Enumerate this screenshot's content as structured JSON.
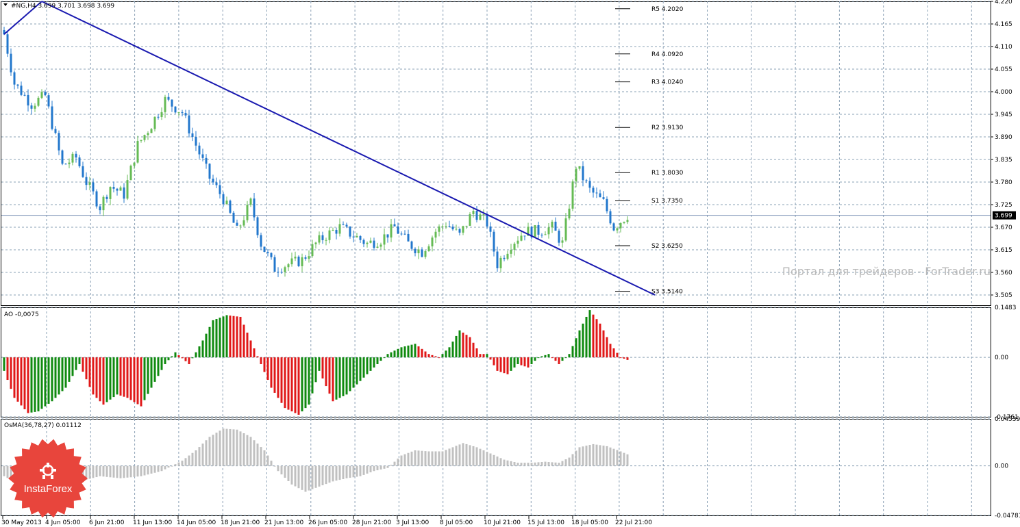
{
  "chart_data": [
    {
      "type": "candlestick",
      "title": "#NG,H4  3.699 3.701 3.698 3.699",
      "symbol": "#NG,H4",
      "ohlc_header": "3.699 3.701 3.698 3.699",
      "ylim": [
        3.48,
        4.22
      ],
      "y_ticks": [
        "4.220",
        "4.165",
        "4.110",
        "4.055",
        "4.000",
        "3.945",
        "3.890",
        "3.835",
        "3.780",
        "3.725",
        "3.670",
        "3.615",
        "3.560",
        "3.505"
      ],
      "current_price_label": "3.699",
      "current_price": 3.699,
      "colors": {
        "bull": "#66bb55",
        "bear": "#2277cc",
        "trendline": "#1a1ab0",
        "grid": "#8aa0b5"
      },
      "close_path": [
        [
          0,
          4.14
        ],
        [
          3,
          4.02
        ],
        [
          8,
          3.97
        ],
        [
          12,
          3.99
        ],
        [
          17,
          3.82
        ],
        [
          21,
          3.84
        ],
        [
          24,
          3.78
        ],
        [
          28,
          3.72
        ],
        [
          31,
          3.77
        ],
        [
          35,
          3.75
        ],
        [
          39,
          3.87
        ],
        [
          43,
          3.92
        ],
        [
          47,
          3.98
        ],
        [
          52,
          3.95
        ],
        [
          56,
          3.87
        ],
        [
          60,
          3.79
        ],
        [
          64,
          3.74
        ],
        [
          68,
          3.66
        ],
        [
          72,
          3.73
        ],
        [
          75,
          3.63
        ],
        [
          79,
          3.57
        ],
        [
          83,
          3.58
        ],
        [
          87,
          3.59
        ],
        [
          91,
          3.63
        ],
        [
          94,
          3.65
        ],
        [
          98,
          3.67
        ],
        [
          102,
          3.65
        ],
        [
          106,
          3.63
        ],
        [
          110,
          3.64
        ],
        [
          114,
          3.67
        ],
        [
          118,
          3.63
        ],
        [
          122,
          3.61
        ],
        [
          126,
          3.66
        ],
        [
          129,
          3.68
        ],
        [
          133,
          3.65
        ],
        [
          137,
          3.71
        ],
        [
          141,
          3.68
        ],
        [
          144,
          3.58
        ],
        [
          148,
          3.63
        ],
        [
          152,
          3.66
        ],
        [
          156,
          3.66
        ],
        [
          160,
          3.67
        ],
        [
          163,
          3.63
        ],
        [
          167,
          3.82
        ],
        [
          171,
          3.76
        ],
        [
          175,
          3.73
        ],
        [
          178,
          3.67
        ],
        [
          182,
          3.7
        ]
      ],
      "trendlines": [
        {
          "from": [
            0,
            4.14
          ],
          "to": [
            11,
            4.22
          ]
        },
        {
          "from": [
            11,
            4.22
          ],
          "to": [
            190,
            3.505
          ]
        }
      ],
      "pivot_levels": [
        {
          "label": "R5  4.2020",
          "value": 4.202
        },
        {
          "label": "R4  4.0920",
          "value": 4.092
        },
        {
          "label": "R3  4.0240",
          "value": 4.024
        },
        {
          "label": "R2  3.9130",
          "value": 3.913
        },
        {
          "label": "R1  3.8030",
          "value": 3.803
        },
        {
          "label": "S1  3.7350",
          "value": 3.735
        },
        {
          "label": "S2  3.6250",
          "value": 3.625
        },
        {
          "label": "S3  3.5140",
          "value": 3.514
        }
      ],
      "watermark": "Портал для трейдеров - ForTrader.ru"
    },
    {
      "type": "bar",
      "title": "AO -0,0075",
      "ylim": [
        -0.1761,
        0.1483
      ],
      "y_ticks": [
        "0.1483",
        "0.00",
        "-0.1761"
      ],
      "colors": {
        "up": "#0f8a0f",
        "down": "#e01818"
      },
      "values_path": [
        [
          0,
          -0.04
        ],
        [
          3,
          -0.12
        ],
        [
          7,
          -0.165
        ],
        [
          10,
          -0.16
        ],
        [
          14,
          -0.13
        ],
        [
          18,
          -0.09
        ],
        [
          22,
          -0.02
        ],
        [
          26,
          -0.11
        ],
        [
          29,
          -0.14
        ],
        [
          33,
          -0.11
        ],
        [
          36,
          -0.12
        ],
        [
          40,
          -0.145
        ],
        [
          43,
          -0.09
        ],
        [
          47,
          -0.02
        ],
        [
          50,
          0.015
        ],
        [
          54,
          -0.02
        ],
        [
          58,
          0.05
        ],
        [
          61,
          0.11
        ],
        [
          65,
          0.125
        ],
        [
          69,
          0.12
        ],
        [
          72,
          0.05
        ],
        [
          75,
          -0.02
        ],
        [
          78,
          -0.09
        ],
        [
          82,
          -0.15
        ],
        [
          86,
          -0.17
        ],
        [
          89,
          -0.14
        ],
        [
          92,
          -0.04
        ],
        [
          96,
          -0.13
        ],
        [
          100,
          -0.11
        ],
        [
          104,
          -0.07
        ],
        [
          108,
          -0.03
        ],
        [
          112,
          0.01
        ],
        [
          116,
          0.03
        ],
        [
          120,
          0.04
        ],
        [
          124,
          0.01
        ],
        [
          127,
          0.0
        ],
        [
          130,
          0.03
        ],
        [
          133,
          0.08
        ],
        [
          136,
          0.06
        ],
        [
          139,
          0.01
        ],
        [
          141,
          0.01
        ],
        [
          144,
          -0.04
        ],
        [
          147,
          -0.05
        ],
        [
          150,
          -0.02
        ],
        [
          153,
          -0.03
        ],
        [
          156,
          0.0
        ],
        [
          159,
          0.01
        ],
        [
          162,
          -0.02
        ],
        [
          165,
          0.01
        ],
        [
          168,
          0.08
        ],
        [
          171,
          0.14
        ],
        [
          174,
          0.1
        ],
        [
          177,
          0.04
        ],
        [
          180,
          0.0
        ],
        [
          182,
          -0.0075
        ]
      ]
    },
    {
      "type": "bar",
      "title": "OsMA(36,78,27) 0.01112",
      "ylim": [
        -0.04781,
        0.04539
      ],
      "y_ticks": [
        "0.04539",
        "0.00",
        "-0.04781"
      ],
      "colors": {
        "bars": "#c0c0c0"
      },
      "values_path": [
        [
          0,
          -0.01
        ],
        [
          6,
          -0.02
        ],
        [
          12,
          -0.03
        ],
        [
          17,
          -0.025
        ],
        [
          22,
          -0.015
        ],
        [
          28,
          -0.01
        ],
        [
          34,
          -0.012
        ],
        [
          40,
          -0.01
        ],
        [
          46,
          -0.005
        ],
        [
          52,
          0.005
        ],
        [
          56,
          0.015
        ],
        [
          60,
          0.028
        ],
        [
          64,
          0.036
        ],
        [
          68,
          0.035
        ],
        [
          72,
          0.028
        ],
        [
          76,
          0.015
        ],
        [
          80,
          -0.005
        ],
        [
          84,
          -0.018
        ],
        [
          88,
          -0.025
        ],
        [
          92,
          -0.02
        ],
        [
          96,
          -0.015
        ],
        [
          100,
          -0.012
        ],
        [
          104,
          -0.01
        ],
        [
          108,
          -0.005
        ],
        [
          112,
          -0.002
        ],
        [
          116,
          0.01
        ],
        [
          120,
          0.015
        ],
        [
          124,
          0.014
        ],
        [
          128,
          0.014
        ],
        [
          131,
          0.018
        ],
        [
          134,
          0.022
        ],
        [
          138,
          0.018
        ],
        [
          142,
          0.012
        ],
        [
          146,
          0.006
        ],
        [
          150,
          0.003
        ],
        [
          154,
          0.003
        ],
        [
          158,
          0.004
        ],
        [
          162,
          0.003
        ],
        [
          165,
          0.008
        ],
        [
          168,
          0.018
        ],
        [
          172,
          0.021
        ],
        [
          176,
          0.019
        ],
        [
          180,
          0.014
        ],
        [
          182,
          0.01112
        ]
      ]
    }
  ],
  "x_axis": {
    "labels": [
      "30 May 2013",
      "4 Jun 05:00",
      "6 Jun 21:00",
      "11 Jun 13:00",
      "14 Jun 05:00",
      "18 Jun 21:00",
      "21 Jun 13:00",
      "26 Jun 05:00",
      "28 Jun 21:00",
      "3 Jul 13:00",
      "8 Jul 05:00",
      "10 Jul 21:00",
      "15 Jul 13:00",
      "18 Jul 05:00",
      "22 Jul 21:00"
    ]
  },
  "logo": {
    "text": "InstaForex",
    "color": "#e8453c"
  }
}
